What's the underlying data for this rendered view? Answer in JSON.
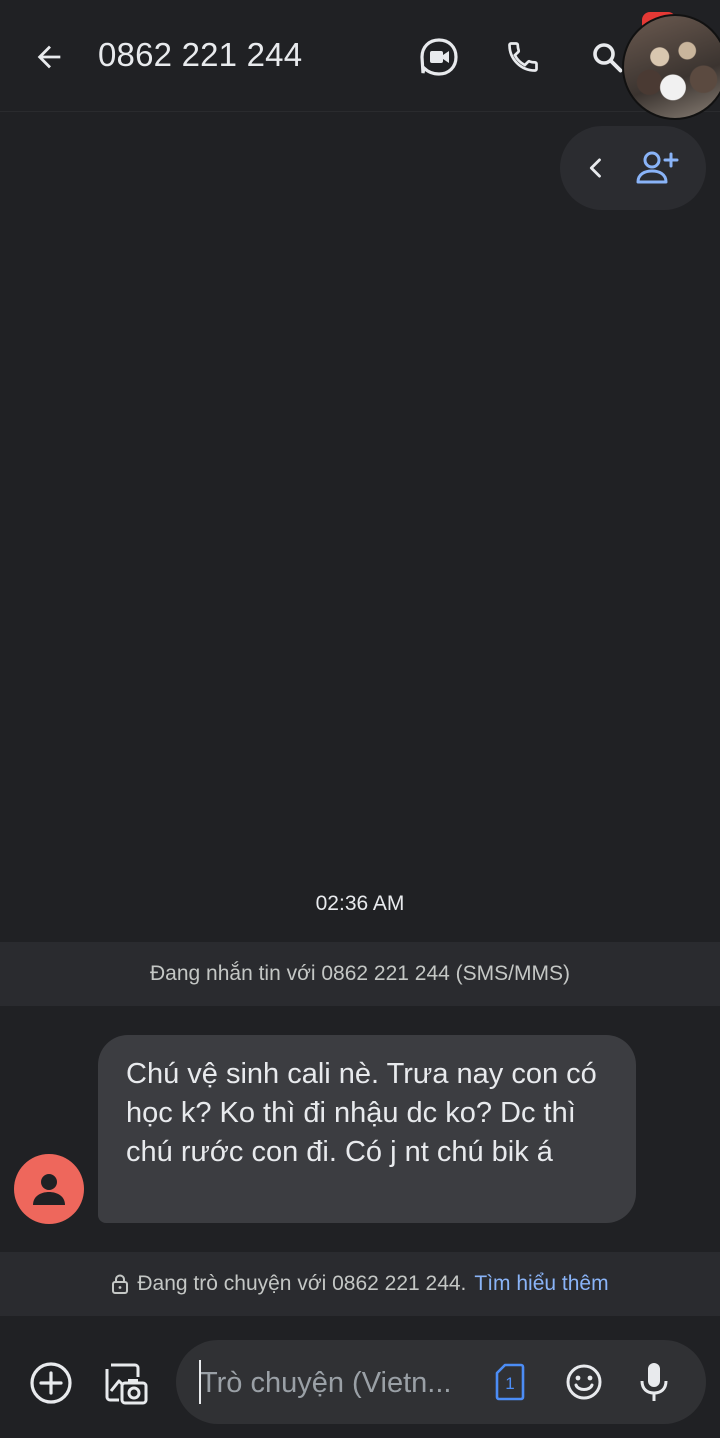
{
  "header": {
    "title": "0862 221 244"
  },
  "actions": {
    "icons": [
      "back-arrow-icon",
      "video-call-icon",
      "phone-icon",
      "search-icon",
      "chevron-left-icon",
      "add-contact-icon"
    ]
  },
  "conversation": {
    "timestamp": "02:36 AM",
    "sms_banner": "Đang nhắn tin với 0862 221 244 (SMS/MMS)",
    "messages": [
      {
        "text": "Chú vệ sinh cali nè. Trưa nay con có học k? Ko thì đi nhậu dc ko? Dc thì chú rước con đi. Có j nt chú bik á"
      }
    ],
    "secure_banner": {
      "text": "Đang trò chuyện với 0862 221 244.",
      "link": "Tìm hiểu thêm"
    }
  },
  "composer": {
    "placeholder": "Trò chuyện (Vietn...",
    "sim_number": "1"
  },
  "colors": {
    "background": "#202124",
    "bubble": "#3c3d41",
    "avatar": "#ee675c",
    "accent": "#8ab4f8"
  }
}
